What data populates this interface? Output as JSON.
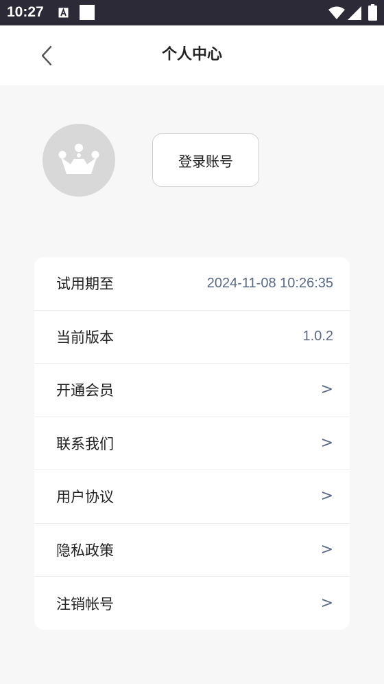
{
  "status_bar": {
    "time": "10:27",
    "icons": [
      "a-notification-icon",
      "square-notification-icon",
      "wifi-icon",
      "signal-icon",
      "battery-icon"
    ]
  },
  "header": {
    "title": "个人中心",
    "back_icon": "chevron-left-icon"
  },
  "profile": {
    "avatar_icon": "crown-icon",
    "login_label": "登录账号"
  },
  "menu": {
    "items": [
      {
        "label": "试用期至",
        "value": "2024-11-08 10:26:35"
      },
      {
        "label": "当前版本",
        "value": "1.0.2"
      },
      {
        "label": "开通会员",
        "value": ">"
      },
      {
        "label": "联系我们",
        "value": ">"
      },
      {
        "label": "用户协议",
        "value": ">"
      },
      {
        "label": "隐私政策",
        "value": ">"
      },
      {
        "label": "注销帐号",
        "value": ">"
      }
    ]
  },
  "colors": {
    "status_bar": "#2b2a36",
    "background": "#f7f7f7",
    "card": "#ffffff",
    "value_text": "#5a6a85",
    "avatar": "#d8d8d8"
  }
}
